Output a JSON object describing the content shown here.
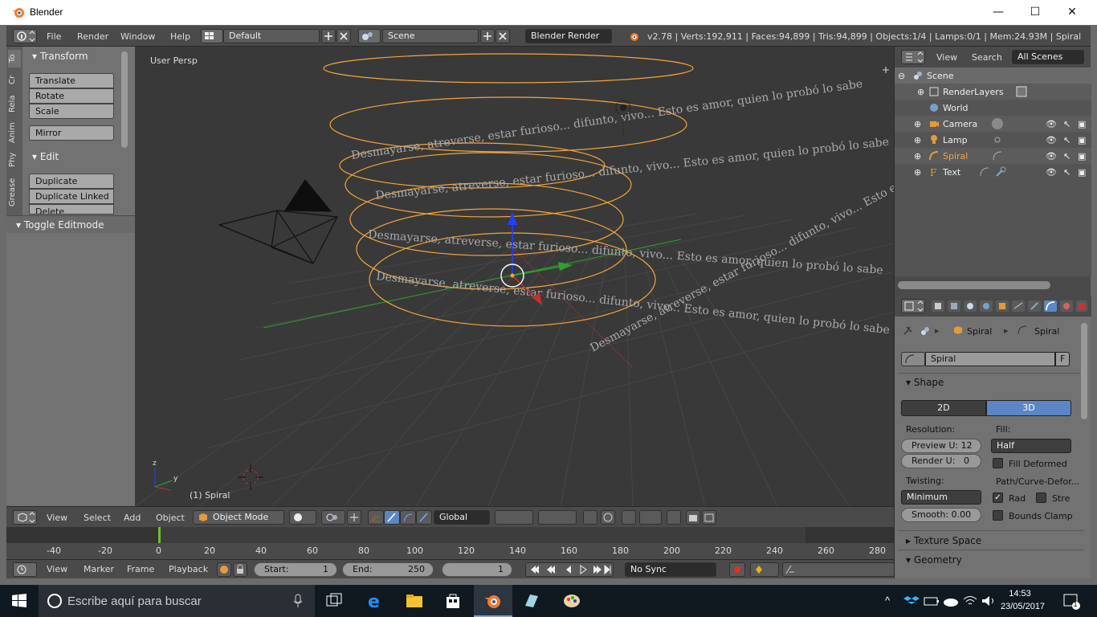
{
  "window": {
    "title": "Blender",
    "min": "—",
    "max": "☐",
    "close": "✕"
  },
  "topbar": {
    "menus": [
      "File",
      "Render",
      "Window",
      "Help"
    ],
    "layout": "Default",
    "scene": "Scene",
    "engine": "Blender Render",
    "status": "v2.78 | Verts:192,911 | Faces:94,899 | Tris:94,899 | Objects:1/4 | Lamps:0/1 | Mem:24.93M | Spiral"
  },
  "toolshelf": {
    "tabs": [
      "To",
      "Cr",
      "Rela",
      "Anim",
      "Phy",
      "Grease"
    ],
    "transform_header": "Transform",
    "transform_buttons": [
      "Translate",
      "Rotate",
      "Scale"
    ],
    "mirror": "Mirror",
    "edit_header": "Edit",
    "edit_buttons": [
      "Duplicate",
      "Duplicate Linked",
      "Delete"
    ],
    "toggle_header": "Toggle Editmode"
  },
  "viewport": {
    "view_name": "User Persp",
    "object_label": "(1) Spiral",
    "curve_text": "Desmayarse, atreverse, estar furioso... difunto, vivo... Esto es amor, quien lo probó lo sabe",
    "colors": {
      "bg": "#393939",
      "selection": "#f5a43a",
      "grid": "#4a4a4a",
      "x_axis": "#c03030",
      "y_axis": "#2ea02e",
      "z_axis": "#2040ff"
    }
  },
  "vpheader": {
    "menus": [
      "View",
      "Select",
      "Add",
      "Object"
    ],
    "mode": "Object Mode",
    "orientation": "Global"
  },
  "timeline": {
    "ticks": [
      "-40",
      "-20",
      "0",
      "20",
      "40",
      "60",
      "80",
      "100",
      "120",
      "140",
      "160",
      "180",
      "200",
      "220",
      "240",
      "260",
      "280"
    ],
    "menus": [
      "View",
      "Marker",
      "Frame",
      "Playback"
    ],
    "start_label": "Start:",
    "start": "1",
    "end_label": "End:",
    "end": "250",
    "current": "1",
    "sync": "No Sync"
  },
  "outliner": {
    "menus": [
      "View",
      "Search"
    ],
    "filter": "All Scenes",
    "items": [
      {
        "name": "Scene",
        "indent": 0
      },
      {
        "name": "RenderLayers",
        "indent": 1
      },
      {
        "name": "World",
        "indent": 1
      },
      {
        "name": "Camera",
        "indent": 1
      },
      {
        "name": "Lamp",
        "indent": 1
      },
      {
        "name": "Spiral",
        "indent": 1
      },
      {
        "name": "Text",
        "indent": 1
      }
    ]
  },
  "properties": {
    "breadcrumb_object": "Spiral",
    "breadcrumb_data": "Spiral",
    "datablock": "Spiral",
    "fake_user": "F",
    "shape_header": "Shape",
    "dim2": "2D",
    "dim3": "3D",
    "resolution_label": "Resolution:",
    "preview_u": "Preview U: 12",
    "render_u_label": "Render U:",
    "render_u_value": "0",
    "fill_label": "Fill:",
    "fill_value": "Half",
    "fill_deformed": "Fill Deformed",
    "path_label": "Path/Curve-Defor...",
    "twisting_label": "Twisting:",
    "twisting_value": "Minimum",
    "rad": "Rad",
    "stre": "Stre",
    "smooth": "Smooth:  0.00",
    "bounds_clamp": "Bounds Clamp",
    "texture_space": "Texture Space",
    "geometry": "Geometry"
  },
  "taskbar": {
    "search_placeholder": "Escribe aquí para buscar",
    "time": "14:53",
    "date": "23/05/2017",
    "notif": "1"
  }
}
